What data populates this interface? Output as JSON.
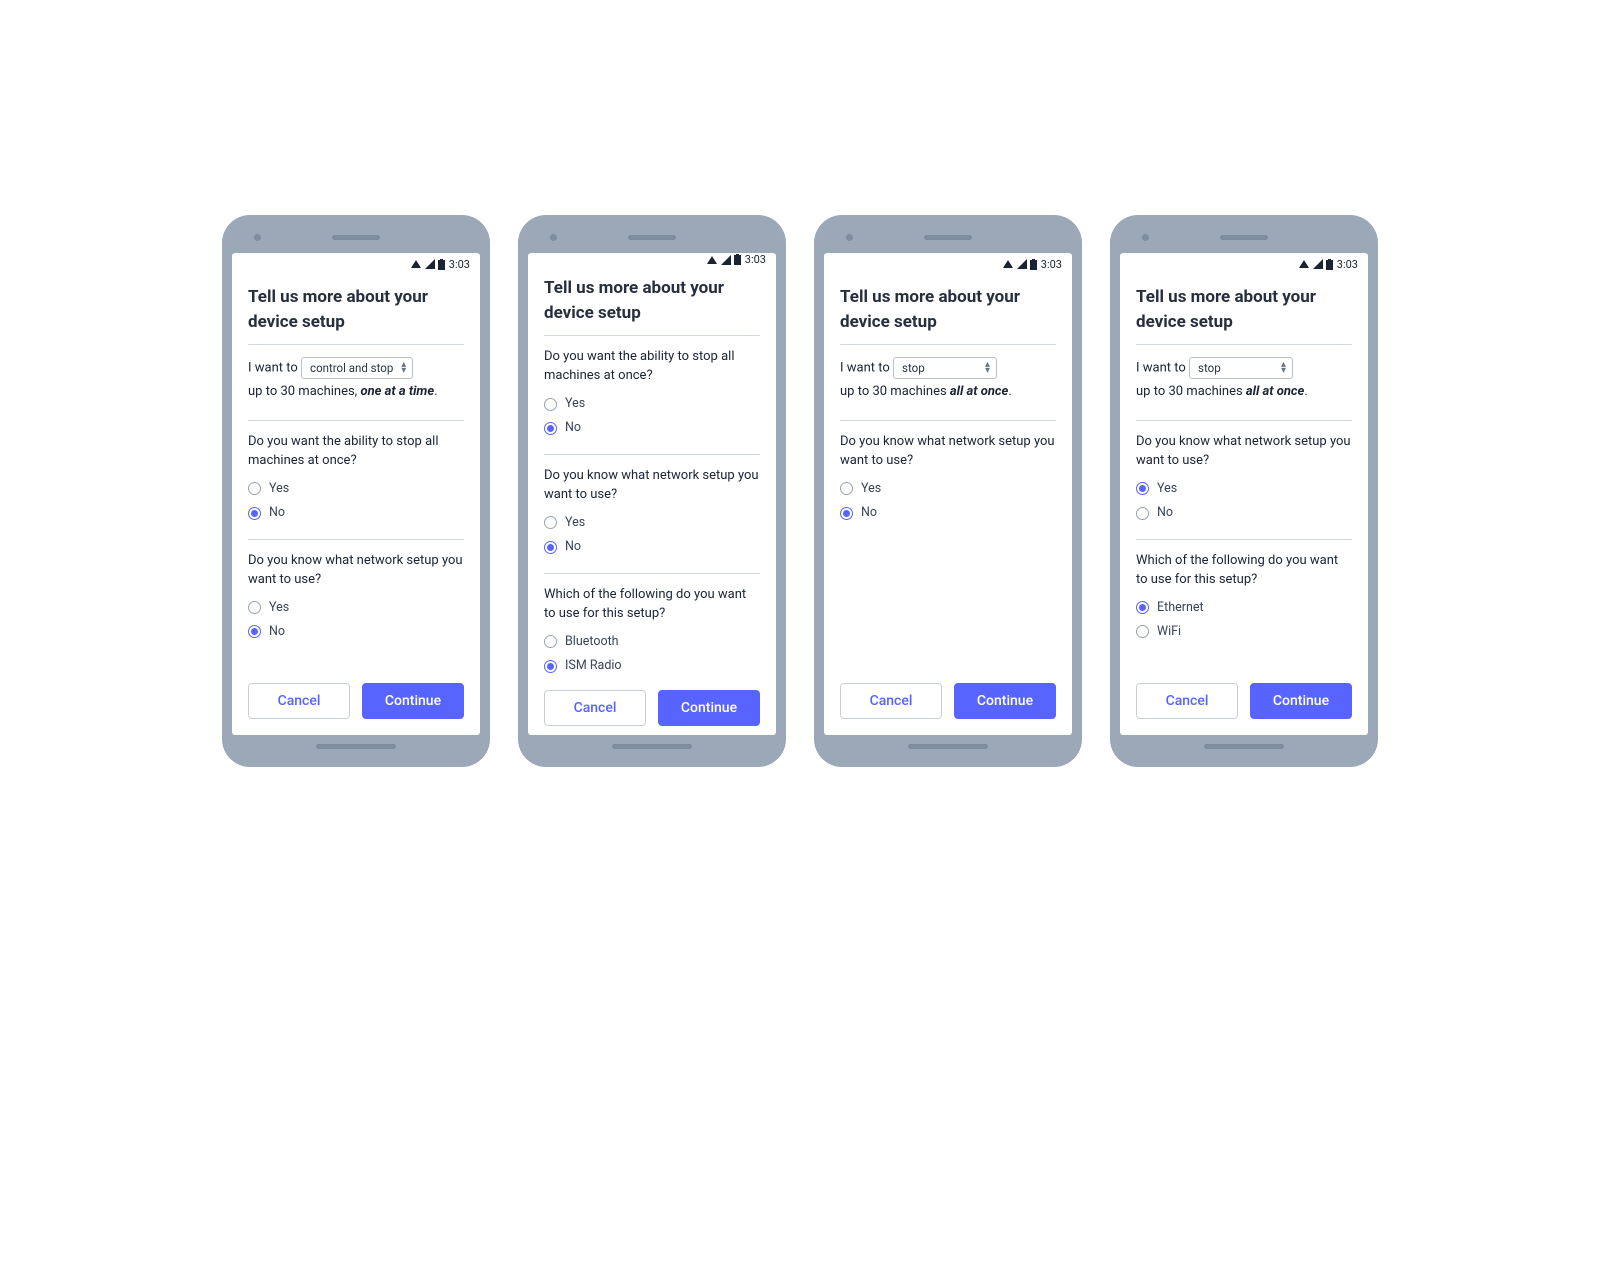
{
  "statusbar": {
    "time": "3:03"
  },
  "title": "Tell us more about your device setup",
  "buttons": {
    "cancel": "Cancel",
    "continue": "Continue"
  },
  "sentence": {
    "prefix": "I want to",
    "line2_prefix": "up to 30 machines, ",
    "line2_prefix_alt": "up to 30 machines ",
    "suffix_one_at_a_time": "one at a time",
    "suffix_all_at_once": "all at once",
    "period": "."
  },
  "select": {
    "control_and_stop": "control and stop",
    "stop": "stop"
  },
  "questions": {
    "stop_all": "Do you want the ability to stop all machines at once?",
    "network_known": "Do you know what network setup you want to use?",
    "which_setup": "Which of the following do you want to use for this setup?"
  },
  "radio": {
    "yes": "Yes",
    "no": "No",
    "bluetooth": "Bluetooth",
    "ism": "ISM Radio",
    "ethernet": "Ethernet",
    "wifi": "WiFi"
  },
  "mocks": [
    {
      "select_key": "control_and_stop",
      "line2_variant": "one",
      "blocks": [
        {
          "q": "stop_all",
          "opts": [
            "yes",
            "no"
          ],
          "selected": "no"
        },
        {
          "q": "network_known",
          "opts": [
            "yes",
            "no"
          ],
          "selected": "no"
        }
      ]
    },
    {
      "hide_sentence": true,
      "blocks": [
        {
          "q": "stop_all",
          "opts": [
            "yes",
            "no"
          ],
          "selected": "no"
        },
        {
          "q": "network_known",
          "opts": [
            "yes",
            "no"
          ],
          "selected": "no"
        },
        {
          "q": "which_setup",
          "opts": [
            "bluetooth",
            "ism"
          ],
          "selected": "ism"
        }
      ]
    },
    {
      "select_key": "stop",
      "line2_variant": "all",
      "blocks": [
        {
          "q": "network_known",
          "opts": [
            "yes",
            "no"
          ],
          "selected": "no"
        }
      ]
    },
    {
      "select_key": "stop",
      "line2_variant": "all",
      "blocks": [
        {
          "q": "network_known",
          "opts": [
            "yes",
            "no"
          ],
          "selected": "yes"
        },
        {
          "q": "which_setup",
          "opts": [
            "ethernet",
            "wifi"
          ],
          "selected": "ethernet"
        }
      ]
    }
  ]
}
